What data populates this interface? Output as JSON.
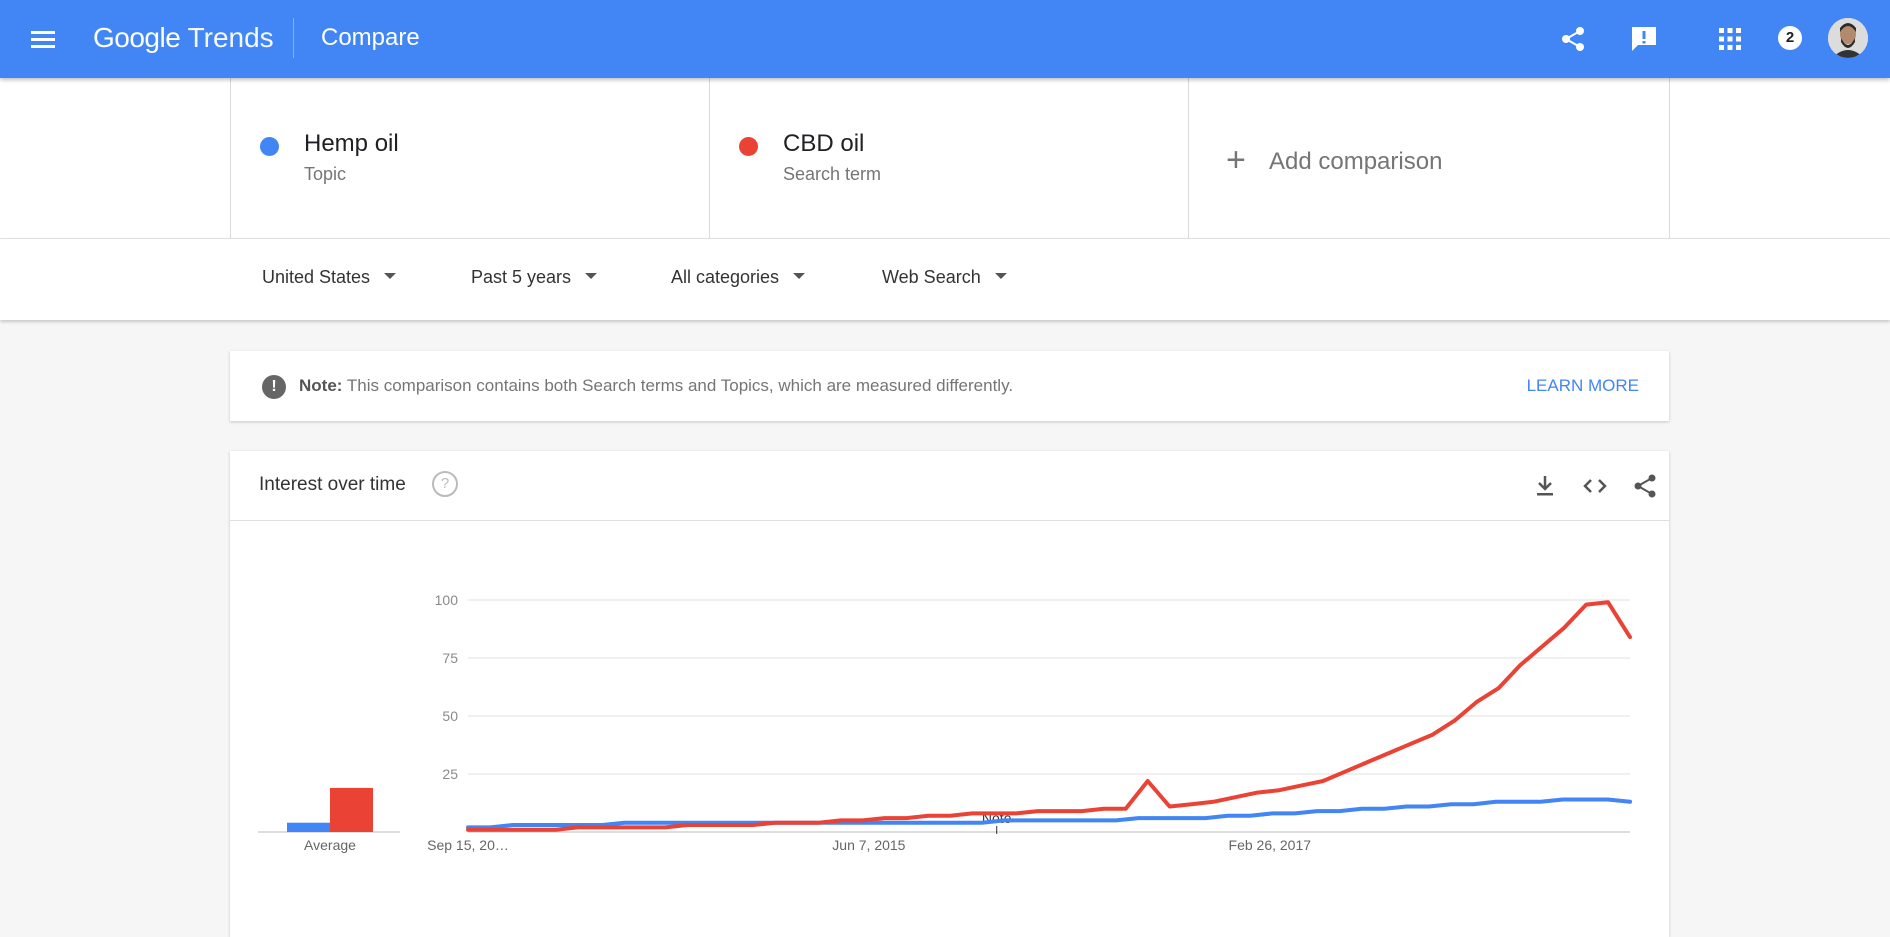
{
  "app": {
    "logo_google": "Google",
    "logo_trends": "Trends",
    "page_title": "Compare",
    "notification_count": "2"
  },
  "icons": {
    "menu": "menu-icon",
    "share": "share-icon",
    "feedback": "feedback-icon",
    "apps": "apps-grid-icon",
    "download": "download-icon",
    "embed": "embed-code-icon",
    "chart_share": "share-icon",
    "help": "help-circle-icon",
    "note": "exclamation-icon"
  },
  "terms": [
    {
      "name": "Hemp oil",
      "type": "Topic",
      "color": "#4285f4"
    },
    {
      "name": "CBD oil",
      "type": "Search term",
      "color": "#ea4335"
    }
  ],
  "add_comparison": {
    "plus": "+",
    "label": "Add comparison"
  },
  "filters": {
    "region": "United States",
    "time": "Past 5 years",
    "category": "All categories",
    "search_type": "Web Search"
  },
  "note": {
    "bold": "Note:",
    "text": "This comparison contains both Search terms and Topics, which are measured differently.",
    "action": "LEARN MORE"
  },
  "interest_card": {
    "title": "Interest over time",
    "help": "?"
  },
  "chart_data": {
    "type": "line",
    "title": "Interest over time",
    "ylim": [
      0,
      100
    ],
    "y_ticks": [
      100,
      75,
      50,
      25
    ],
    "x_tick_labels": [
      "Sep 15, 20…",
      "Jun 7, 2015",
      "Feb 26, 2017"
    ],
    "annotation": "Note",
    "grid": true,
    "series": [
      {
        "name": "Hemp oil",
        "color": "#4285f4",
        "average": 4,
        "values": [
          2,
          2,
          3,
          3,
          3,
          3,
          3,
          4,
          4,
          4,
          4,
          4,
          4,
          4,
          4,
          4,
          4,
          4,
          4,
          4,
          4,
          4,
          4,
          4,
          5,
          5,
          5,
          5,
          5,
          5,
          6,
          6,
          6,
          6,
          7,
          7,
          8,
          8,
          9,
          9,
          10,
          10,
          11,
          11,
          12,
          12,
          13,
          13,
          13,
          14,
          14,
          14,
          13
        ]
      },
      {
        "name": "CBD oil",
        "color": "#ea4335",
        "average": 19,
        "values": [
          1,
          1,
          1,
          1,
          1,
          2,
          2,
          2,
          2,
          2,
          3,
          3,
          3,
          3,
          4,
          4,
          4,
          5,
          5,
          6,
          6,
          7,
          7,
          8,
          8,
          8,
          9,
          9,
          9,
          10,
          10,
          22,
          11,
          12,
          13,
          15,
          17,
          18,
          20,
          22,
          26,
          30,
          34,
          38,
          42,
          48,
          56,
          62,
          72,
          80,
          88,
          98,
          99,
          84
        ]
      }
    ]
  }
}
